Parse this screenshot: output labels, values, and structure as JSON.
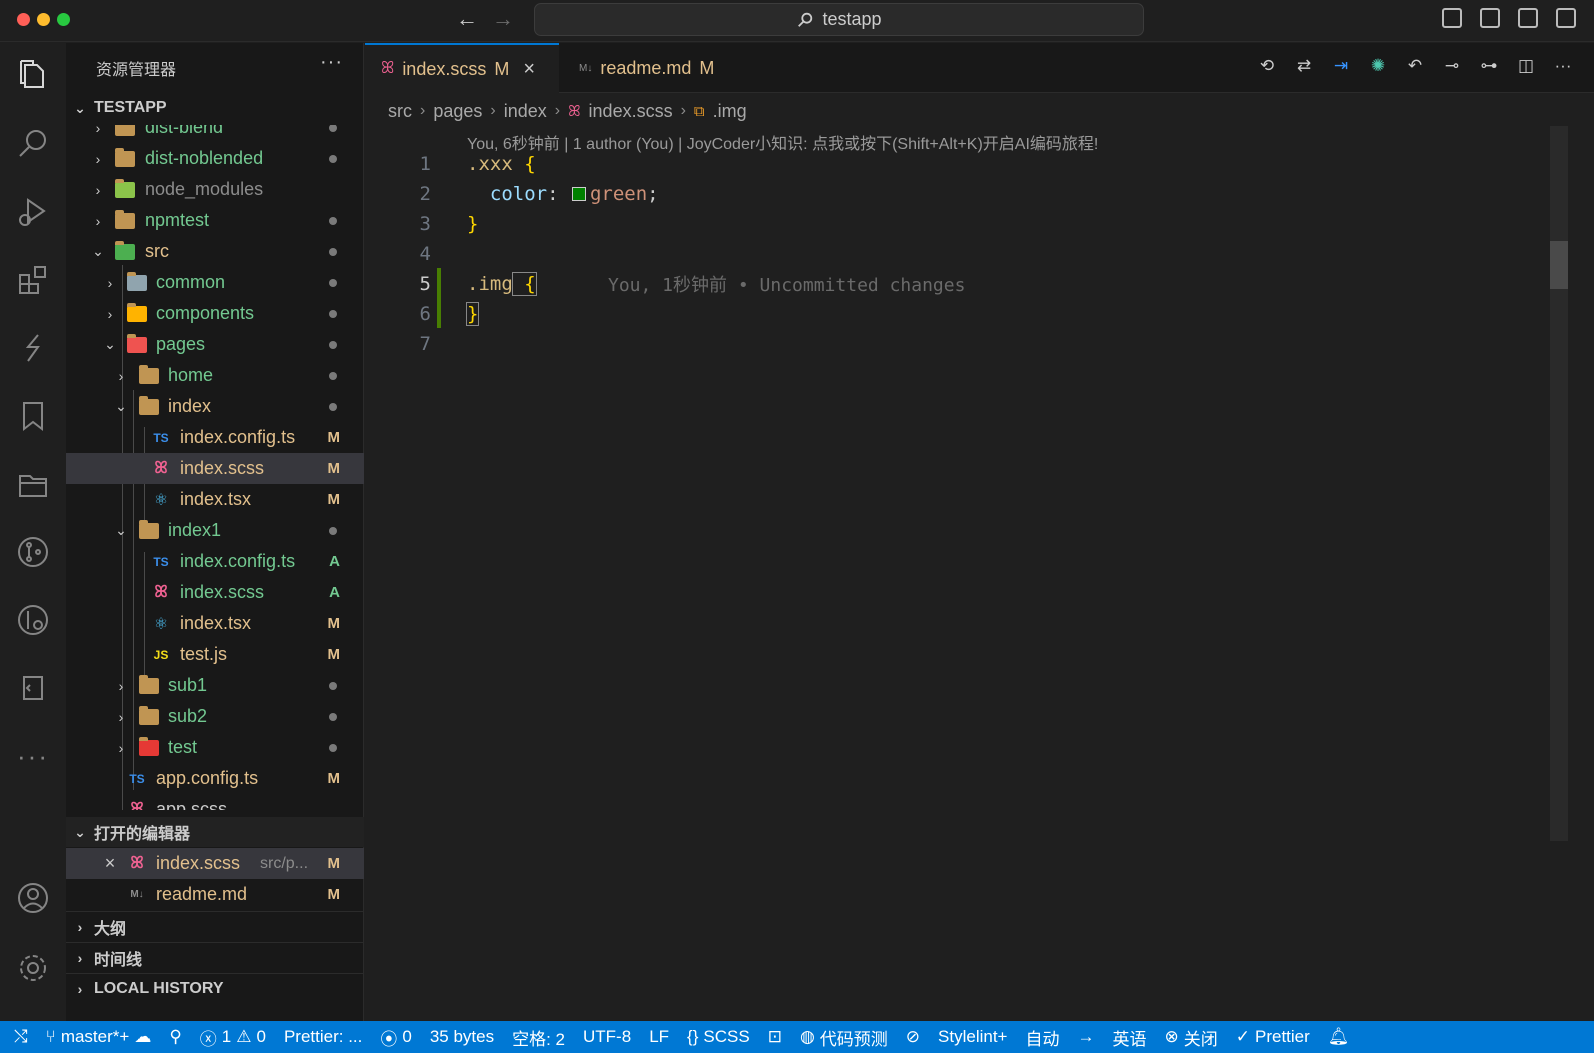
{
  "window": {
    "search_text": "testapp"
  },
  "sidebar": {
    "title": "资源管理器",
    "more": "···",
    "project": "TESTAPP",
    "tree": [
      {
        "label": "dist-blend",
        "badge": "",
        "kind": "folder"
      },
      {
        "label": "dist-noblended",
        "badge": "",
        "kind": "folder"
      },
      {
        "label": "node_modules",
        "badge": "",
        "kind": "folder"
      },
      {
        "label": "npmtest",
        "badge": "",
        "kind": "folder"
      },
      {
        "label": "src",
        "badge": "",
        "kind": "folder"
      },
      {
        "label": "common",
        "badge": "",
        "kind": "folder"
      },
      {
        "label": "components",
        "badge": "",
        "kind": "folder"
      },
      {
        "label": "pages",
        "badge": "",
        "kind": "folder"
      },
      {
        "label": "home",
        "badge": "",
        "kind": "folder"
      },
      {
        "label": "index",
        "badge": "",
        "kind": "folder"
      },
      {
        "label": "index.config.ts",
        "badge": "M",
        "kind": "ts"
      },
      {
        "label": "index.scss",
        "badge": "M",
        "kind": "scss"
      },
      {
        "label": "index.tsx",
        "badge": "M",
        "kind": "react"
      },
      {
        "label": "index1",
        "badge": "",
        "kind": "folder"
      },
      {
        "label": "index.config.ts",
        "badge": "A",
        "kind": "ts"
      },
      {
        "label": "index.scss",
        "badge": "A",
        "kind": "scss"
      },
      {
        "label": "index.tsx",
        "badge": "M",
        "kind": "react"
      },
      {
        "label": "test.js",
        "badge": "M",
        "kind": "js"
      },
      {
        "label": "sub1",
        "badge": "",
        "kind": "folder"
      },
      {
        "label": "sub2",
        "badge": "",
        "kind": "folder"
      },
      {
        "label": "test",
        "badge": "",
        "kind": "folder"
      },
      {
        "label": "app.config.ts",
        "badge": "M",
        "kind": "ts"
      },
      {
        "label": "app.scss",
        "badge": "",
        "kind": "scss"
      }
    ],
    "open_editors": {
      "title": "打开的编辑器",
      "items": [
        {
          "label": "index.scss",
          "path": "src/p...",
          "badge": "M"
        },
        {
          "label": "readme.md",
          "path": "",
          "badge": "M"
        }
      ]
    },
    "outline": "大纲",
    "timeline": "时间线",
    "local_history": "LOCAL HISTORY"
  },
  "tabs": [
    {
      "label": "index.scss",
      "badge": "M",
      "active": true
    },
    {
      "label": "readme.md",
      "badge": "M",
      "active": false
    }
  ],
  "breadcrumb": [
    "src",
    "pages",
    "index",
    "index.scss",
    ".img"
  ],
  "editor": {
    "blame_header": "You, 6秒钟前 | 1 author (You) | JoyCoder小知识: 点我或按下(Shift+Alt+K)开启AI编码旅程!",
    "line_numbers": [
      "1",
      "2",
      "3",
      "4",
      "5",
      "6",
      "7"
    ],
    "lines": {
      "l1_selector": ".xxx",
      "l1_brace": " {",
      "l2_prop": "  color",
      "l2_colon": ": ",
      "l2_value": "green",
      "l2_semi": ";",
      "l3_brace": "}",
      "l5_selector": ".img",
      "l5_brace": " {",
      "l5_ghost": "You, 1秒钟前 • Uncommitted changes",
      "l6_brace": "}"
    }
  },
  "statusbar": {
    "branch": "master*+",
    "errors": "1",
    "warnings": "0",
    "prettier_short": "Prettier: ...",
    "ports": "0",
    "size": "35 bytes",
    "indent": "空格: 2",
    "encoding": "UTF-8",
    "eol": "LF",
    "language": "SCSS",
    "prediction": "代码预测",
    "stylelint": "Stylelint+",
    "auto": "自动",
    "lang2": "英语",
    "close": "关闭",
    "prettier": "Prettier"
  }
}
